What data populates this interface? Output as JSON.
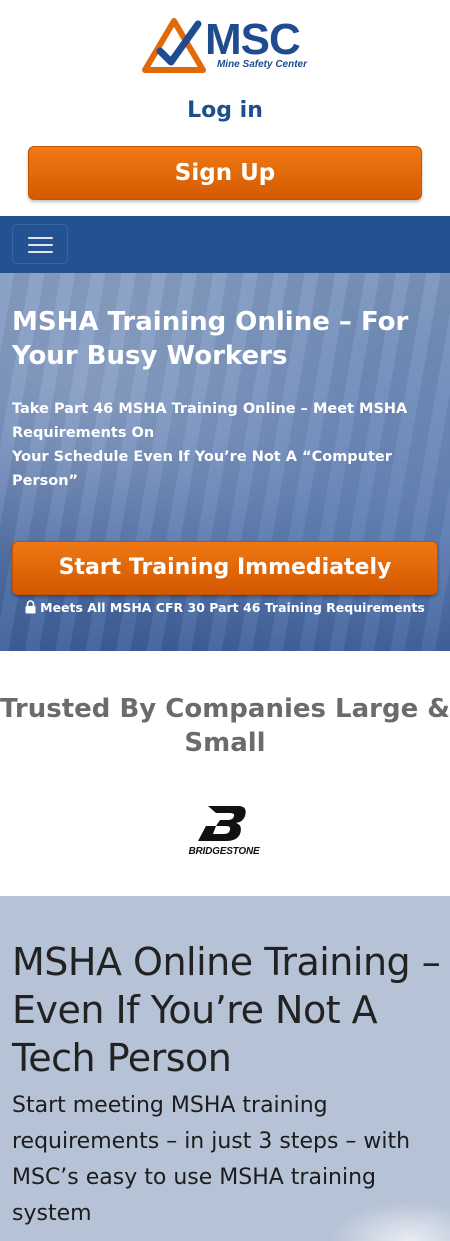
{
  "logo": {
    "text": "MSC",
    "subtitle": "Mine Safety Center"
  },
  "header": {
    "login_label": "Log in",
    "signup_label": "Sign Up"
  },
  "navbar": {
    "toggler_icon": "hamburger-menu-icon"
  },
  "hero": {
    "title": "MSHA Training Online – For Your Busy Workers",
    "subtitle_line1": "Take Part 46 MSHA Training Online – Meet MSHA Requirements On",
    "subtitle_line2": "Your Schedule Even If You’re Not A “Computer Person”",
    "cta_label": "Start Training Immediately",
    "note": "Meets All MSHA CFR 30 Part 46 Training Requirements",
    "note_icon": "lock-icon"
  },
  "trusted": {
    "heading": "Trusted By Companies Large & Small",
    "brand": "BRIDGESTONE"
  },
  "section2": {
    "title": "MSHA Online Training – Even If You’re Not A Tech Person",
    "subtitle": "Start meeting MSHA training requirements – in just 3 steps – with MSC’s easy to use MSHA training system"
  },
  "colors": {
    "brand_blue": "#1e4c8f",
    "accent_orange": "#e06a0a",
    "nav_blue": "#235192",
    "section_bg": "#b6c3d6"
  }
}
